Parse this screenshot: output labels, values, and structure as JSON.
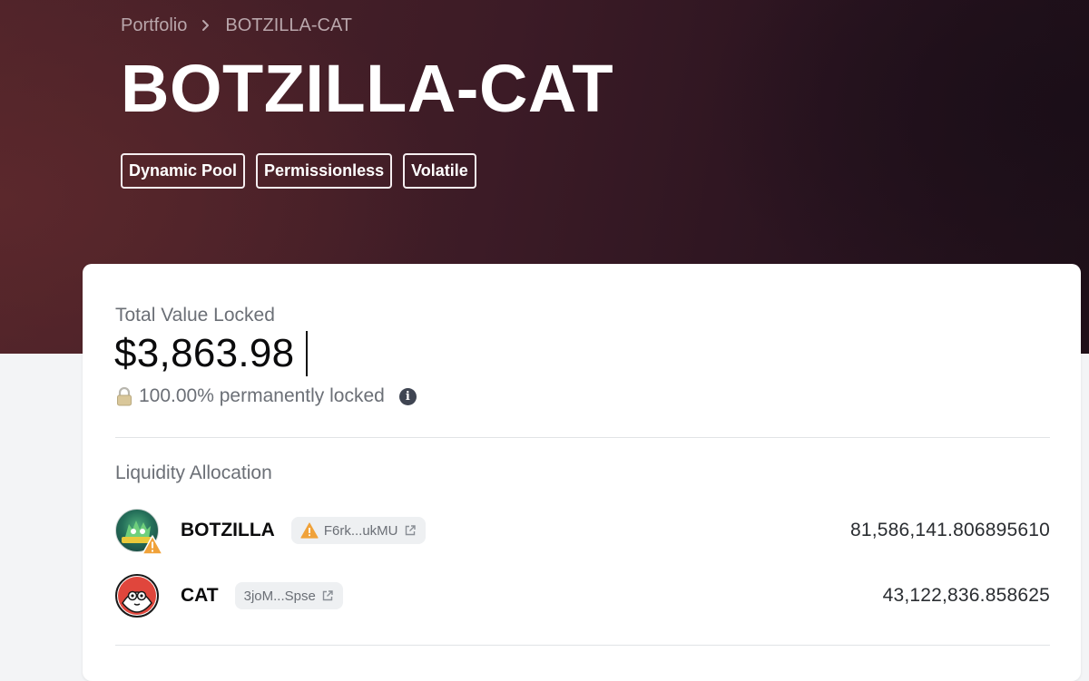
{
  "breadcrumb": {
    "parent": "Portfolio",
    "current": "BOTZILLA-CAT"
  },
  "page_title": "BOTZILLA-CAT",
  "tags": [
    "Dynamic Pool",
    "Permissionless",
    "Volatile"
  ],
  "tvl": {
    "label": "Total Value Locked",
    "value": "$3,863.98",
    "locked_text": "100.00% permanently locked"
  },
  "liquidity": {
    "label": "Liquidity Allocation",
    "tokens": [
      {
        "name": "BOTZILLA",
        "address": "F6rk...ukMU",
        "amount": "81,586,141.806895610",
        "warning": true,
        "avatar_color": "#1f5f5a"
      },
      {
        "name": "CAT",
        "address": "3joM...Spse",
        "amount": "43,122,836.858625",
        "warning": false,
        "avatar_color": "#e0463c"
      }
    ]
  },
  "colors": {
    "hero_start": "#4e2329",
    "hero_end": "#201019",
    "warning": "#f0a23a",
    "card_bg": "#ffffff"
  }
}
